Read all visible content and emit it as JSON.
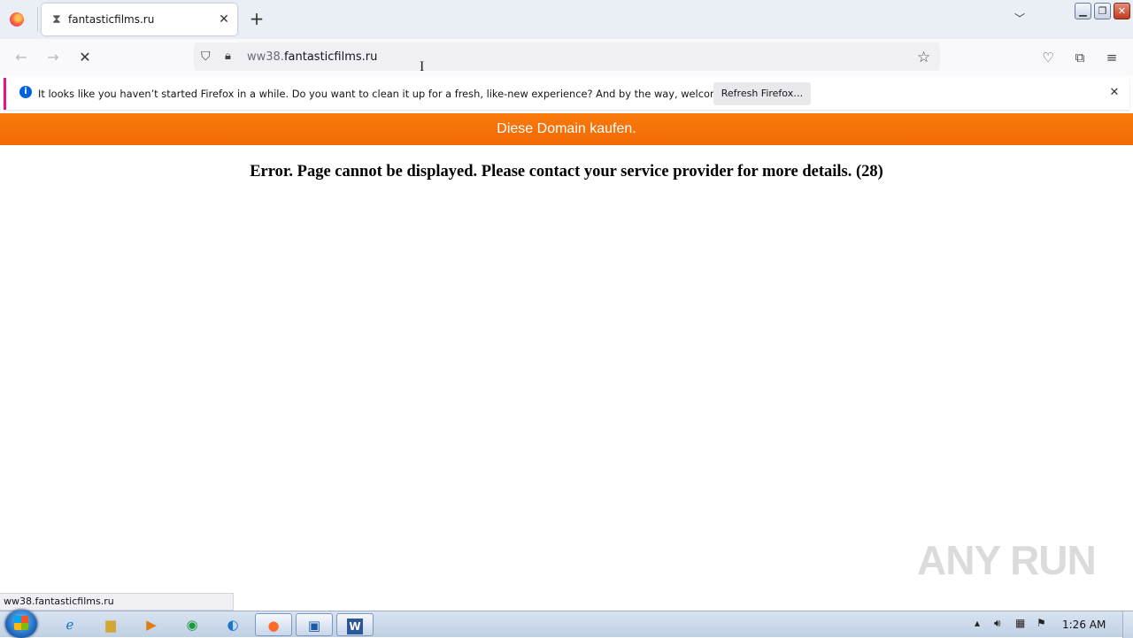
{
  "tab": {
    "title": "fantasticfilms.ru",
    "close_glyph": "✕",
    "loading_icon": "hourglass-icon"
  },
  "toolbar": {
    "new_tab_glyph": "+",
    "back_glyph": "←",
    "forward_glyph": "→",
    "stop_glyph": "✕"
  },
  "urlbar": {
    "subdomain": "ww38.",
    "domain": "fantasticfilms.ru"
  },
  "notification": {
    "info_glyph": "i",
    "message": "It looks like you haven’t started Firefox in a while. Do you want to clean it up for a fresh, like-new experience? And by the way, welcome back!",
    "button_label": "Refresh Firefox…",
    "close_glyph": "✕"
  },
  "page": {
    "banner": "Diese Domain kaufen.",
    "error": "Error. Page cannot be displayed. Please contact your service provider for more details. (28)"
  },
  "status_text": "ww38.fantasticfilms.ru",
  "watermark": "ANY RUN",
  "taskbar": {
    "clock": "1:26 AM",
    "apps": [
      "internet-explorer",
      "file-explorer",
      "media-player",
      "chrome",
      "edge",
      "firefox",
      "remote-desktop",
      "word"
    ]
  },
  "colors": {
    "banner": "#f47508",
    "accent": "#0060df",
    "notice_border": "#e31587"
  }
}
